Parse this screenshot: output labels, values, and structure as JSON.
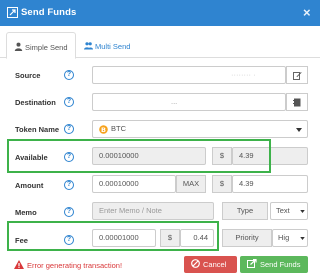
{
  "window": {
    "title": "Send Funds",
    "close_glyph": "×"
  },
  "tabs": [
    {
      "label": "Simple Send",
      "icon": "user-icon"
    },
    {
      "label": "Multi Send",
      "icon": "users-icon"
    }
  ],
  "form": {
    "source": {
      "label": "Source",
      "value": "········ ·"
    },
    "destination": {
      "label": "Destination",
      "value": "..."
    },
    "token_name": {
      "label": "Token Name",
      "value": "BTC",
      "icon": "bitcoin-icon"
    },
    "available": {
      "label": "Available",
      "value": "0.00010000",
      "currency_symbol": "$",
      "usd_value": "4.39"
    },
    "amount": {
      "label": "Amount",
      "value": "0.00010000",
      "max_label": "MAX",
      "currency_symbol": "$",
      "usd_value": "4.39"
    },
    "memo": {
      "label": "Memo",
      "placeholder": "Enter Memo / Note",
      "type_label": "Type",
      "type_value": "Text"
    },
    "fee": {
      "label": "Fee",
      "value": "0.00001000",
      "currency_symbol": "$",
      "usd_value": "0.44",
      "priority_label": "Priority",
      "priority_value": "Hig"
    }
  },
  "footer": {
    "error": "Error generating transaction!",
    "cancel_label": "Cancel",
    "send_label": "Send Funds"
  },
  "colors": {
    "header": "#2f84d0",
    "highlight": "#3db24a",
    "cancel": "#d9534f",
    "send": "#5cb85c",
    "error": "#d9383a"
  }
}
